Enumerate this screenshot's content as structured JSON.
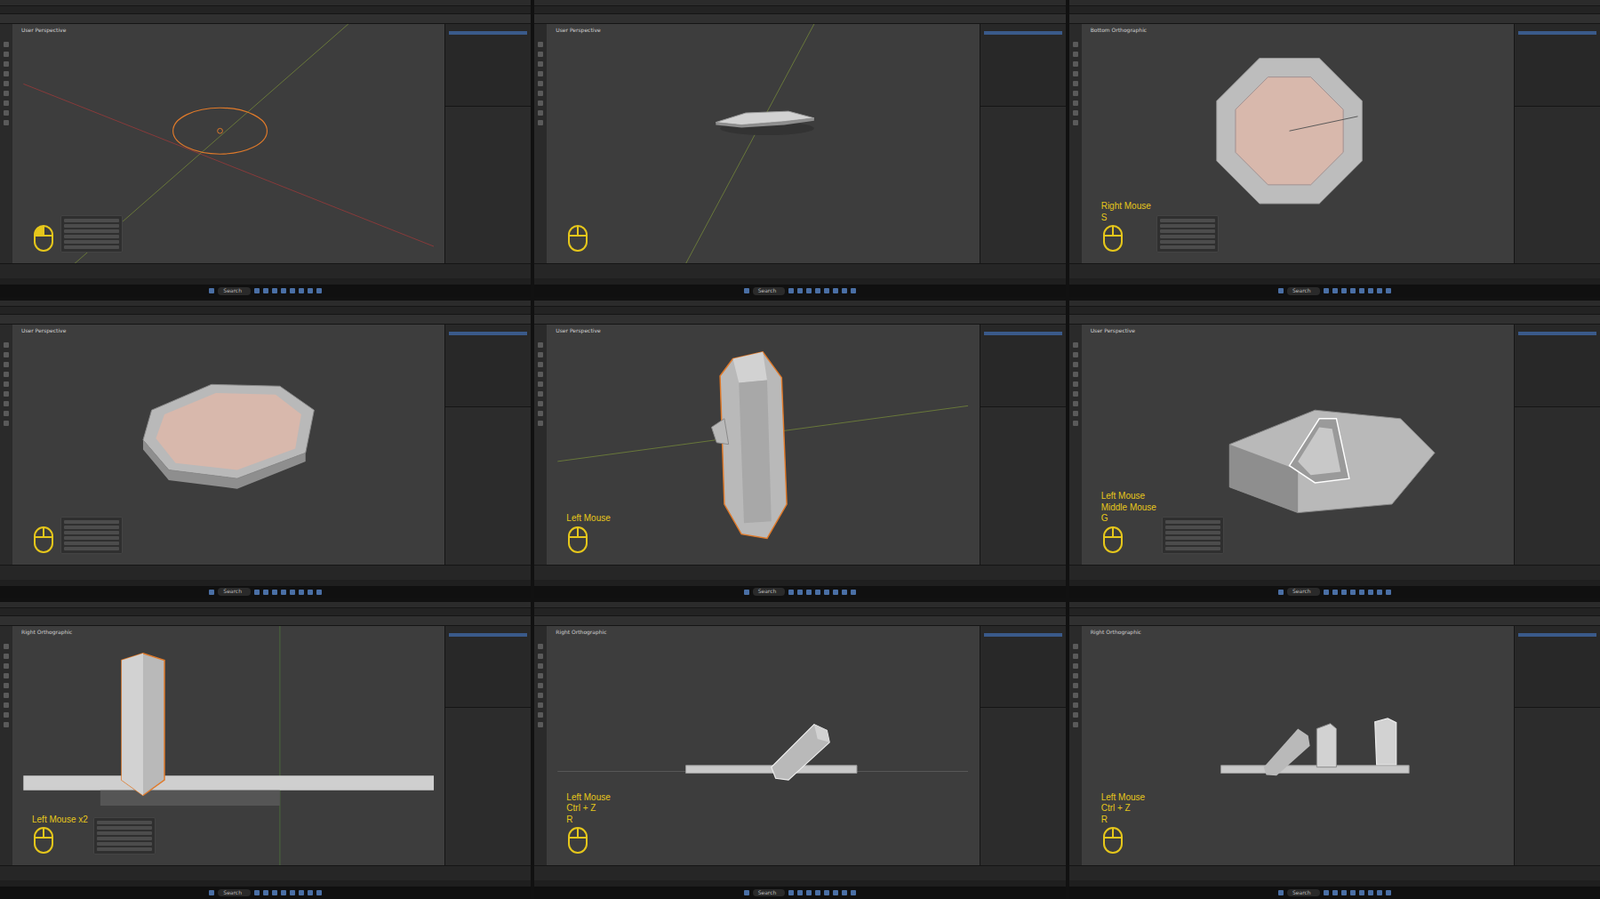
{
  "panels": [
    {
      "view": "User Perspective",
      "scene": "circle",
      "redo_panel": true,
      "mouse": {
        "lines": [],
        "pressed": true
      }
    },
    {
      "view": "User Perspective",
      "scene": "flat-prism",
      "redo_panel": false,
      "mouse": {
        "lines": [],
        "pressed": false
      }
    },
    {
      "view": "Bottom Orthographic",
      "scene": "octagon-top",
      "redo_panel": true,
      "mouse": {
        "lines": [
          "Right Mouse",
          "S"
        ],
        "pressed": false
      }
    },
    {
      "view": "User Perspective",
      "scene": "octagon-slab",
      "redo_panel": true,
      "mouse": {
        "lines": [],
        "pressed": false
      }
    },
    {
      "view": "User Perspective",
      "scene": "crystal-tall",
      "redo_panel": false,
      "mouse": {
        "lines": [
          "Left Mouse"
        ],
        "pressed": false
      }
    },
    {
      "view": "User Perspective",
      "scene": "slab-with-crystal",
      "redo_panel": true,
      "mouse": {
        "lines": [
          "Left Mouse",
          "Middle Mouse",
          "G"
        ],
        "pressed": false
      }
    },
    {
      "view": "Right Orthographic",
      "scene": "crystal-side",
      "redo_panel": true,
      "mouse": {
        "lines": [
          "Left Mouse x2"
        ],
        "pressed": false
      }
    },
    {
      "view": "Right Orthographic",
      "scene": "side-one",
      "redo_panel": false,
      "mouse": {
        "lines": [
          "Left Mouse",
          "Ctrl + Z",
          "R"
        ],
        "pressed": false
      }
    },
    {
      "view": "Right Orthographic",
      "scene": "side-three",
      "redo_panel": false,
      "mouse": {
        "lines": [
          "Left Mouse",
          "Ctrl + Z",
          "R"
        ],
        "pressed": false
      }
    }
  ],
  "taskbar": {
    "search": "Search"
  }
}
